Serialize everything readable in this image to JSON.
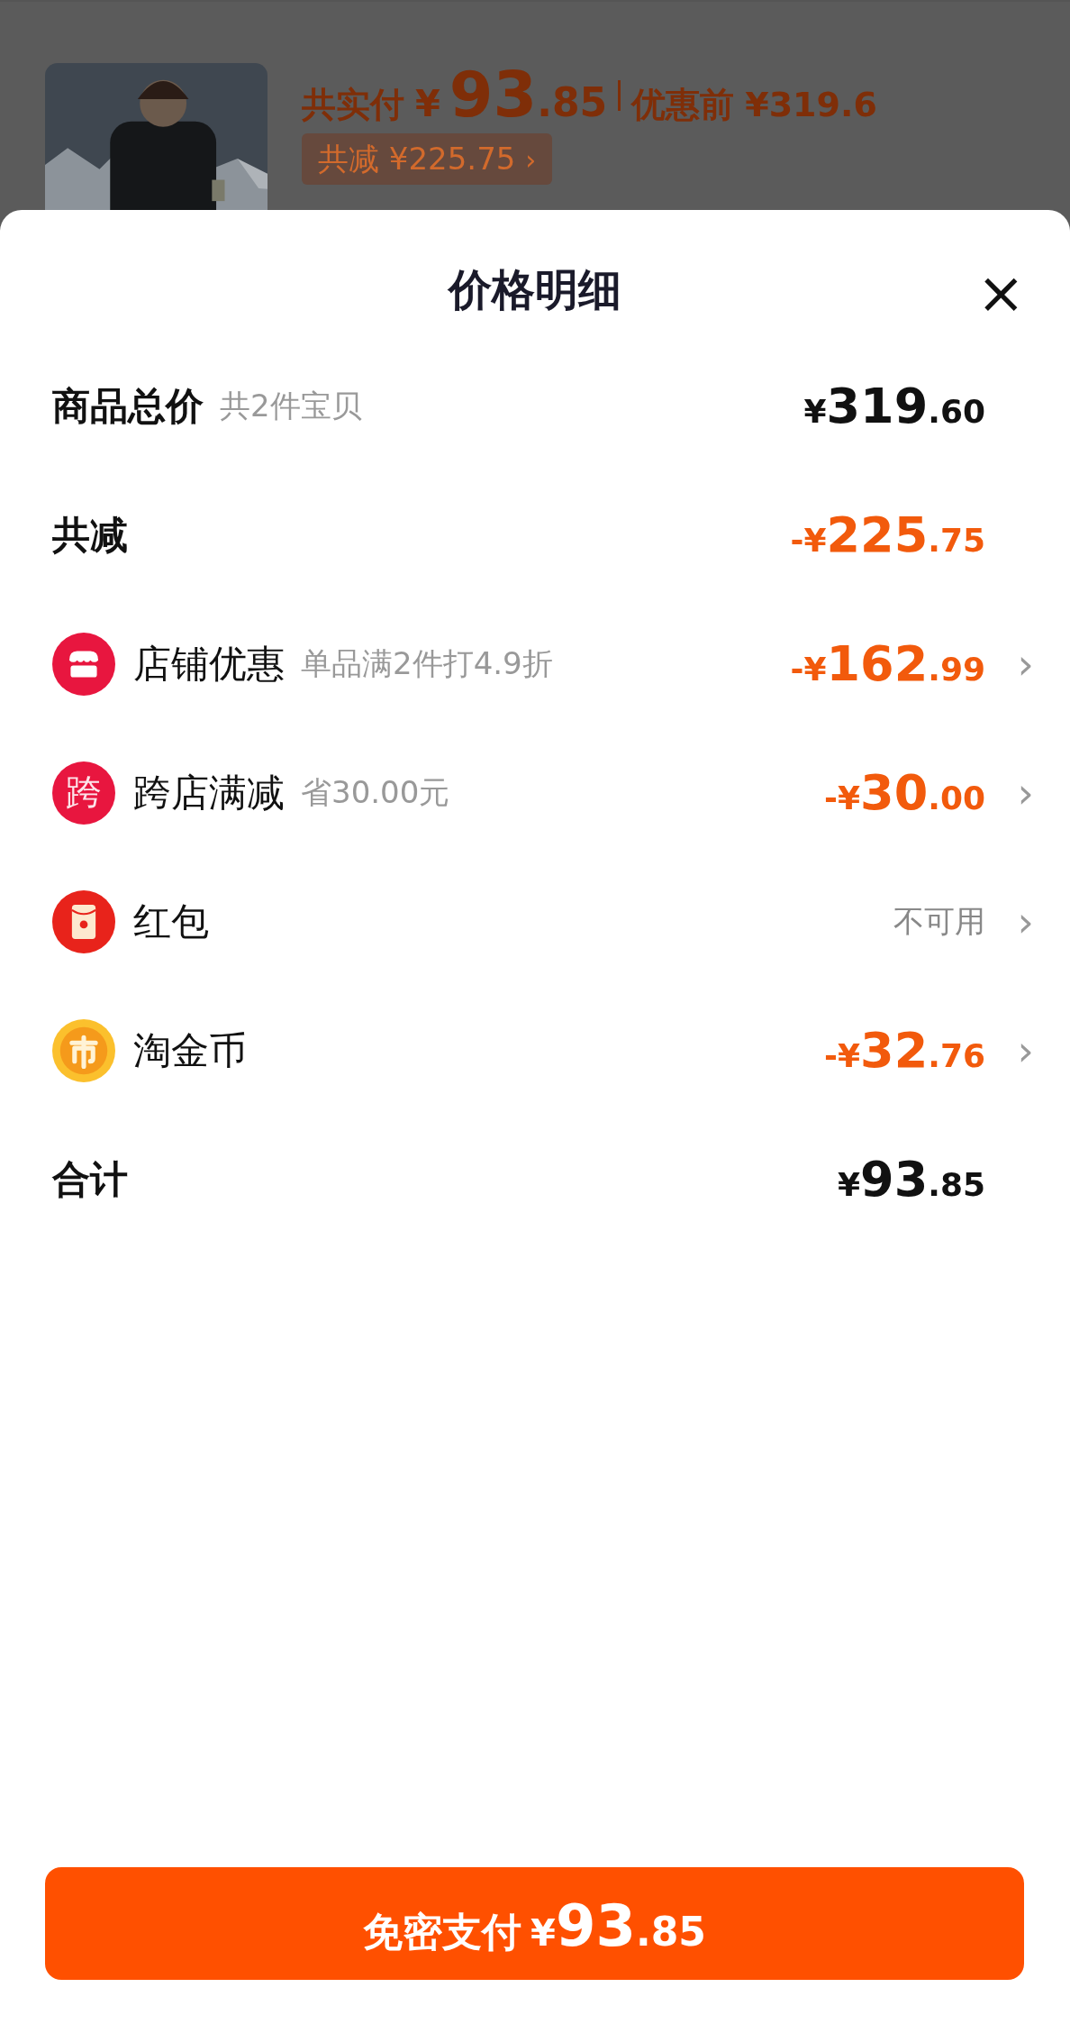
{
  "order_summary": {
    "paid_label": "共实付",
    "paid_amount": "¥93.85",
    "before_label": "优惠前",
    "before_amount": "¥319.6",
    "saved_label": "共减",
    "saved_amount": "¥225.75",
    "chevron": "›"
  },
  "sheet": {
    "title": "价格明细",
    "close": "×",
    "rows": [
      {
        "kind": "plain",
        "label": "商品总价",
        "note": "共2件宝贝",
        "amount": "¥319.60",
        "color": "#111111",
        "chevron": false
      },
      {
        "kind": "plain",
        "label": "共减",
        "amount": "-¥225.75",
        "color": "#f25a0c",
        "chevron": false
      },
      {
        "kind": "shop",
        "label": "店铺优惠",
        "note": "单品满2件打4.9折",
        "amount": "-¥162.99",
        "color": "#f25a0c",
        "chevron": true
      },
      {
        "kind": "text",
        "icon_text": "跨",
        "label": "跨店满减",
        "note": "省30.00元",
        "amount": "-¥30.00",
        "color": "#f25a0c",
        "chevron": true
      },
      {
        "kind": "envelope",
        "label": "红包",
        "amount": "不可用",
        "color": "#888888",
        "chevron": true
      },
      {
        "kind": "coin",
        "label": "淘金币",
        "amount": "-¥32.76",
        "color": "#f25a0c",
        "chevron": true
      },
      {
        "kind": "plain",
        "label": "合计",
        "amount": "¥93.85",
        "color": "#111111",
        "chevron": false
      }
    ],
    "chevron": "›",
    "pay_button": {
      "label": "免密支付",
      "amount": "¥93.85"
    }
  }
}
